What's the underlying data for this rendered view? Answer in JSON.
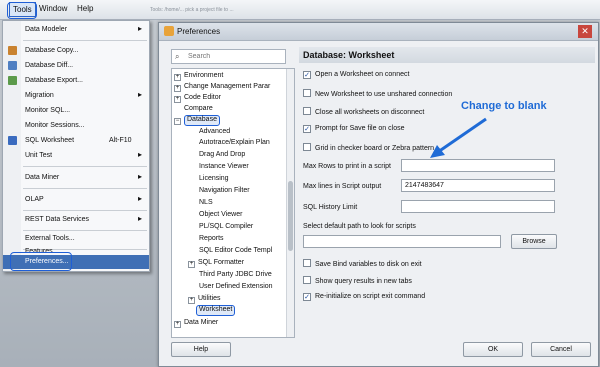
{
  "menubar": {
    "items": [
      "Tools",
      "Window",
      "Help"
    ],
    "bg_text": "Tools: /home/... pick a project file to ..."
  },
  "tools_menu": {
    "items": [
      {
        "label": "Data Modeler",
        "arrow": true,
        "icon": "none"
      },
      {
        "label": "Database Copy...",
        "icon": "db-copy-icon"
      },
      {
        "label": "Database Diff...",
        "icon": "db-diff-icon"
      },
      {
        "label": "Database Export...",
        "icon": "db-export-icon"
      },
      {
        "label": "Migration",
        "arrow": true,
        "icon": "none"
      },
      {
        "label": "Monitor SQL...",
        "icon": "none"
      },
      {
        "label": "Monitor Sessions...",
        "icon": "none"
      },
      {
        "label": "SQL Worksheet",
        "shortcut": "Alt-F10",
        "icon": "sql-worksheet-icon"
      },
      {
        "label": "Unit Test",
        "arrow": true,
        "icon": "none"
      },
      {
        "label": "Data Miner",
        "arrow": true,
        "icon": "none"
      },
      {
        "label": "OLAP",
        "arrow": true,
        "icon": "none"
      },
      {
        "label": "REST Data Services",
        "arrow": true,
        "icon": "none"
      },
      {
        "label": "External Tools...",
        "icon": "none"
      },
      {
        "label": "Features...",
        "icon": "none"
      },
      {
        "label": "Preferences...",
        "icon": "none"
      }
    ]
  },
  "dialog": {
    "title": "Preferences",
    "search_placeholder": "Search",
    "tree": [
      {
        "label": "Environment",
        "pm": "+"
      },
      {
        "label": "Change Management Parar",
        "pm": "+"
      },
      {
        "label": "Code Editor",
        "pm": "+"
      },
      {
        "label": "Compare",
        "pm": ""
      },
      {
        "label": "Database",
        "pm": "−"
      },
      {
        "label": "Advanced",
        "pm": ""
      },
      {
        "label": "Autotrace/Explain Plan",
        "pm": ""
      },
      {
        "label": "Drag And Drop",
        "pm": ""
      },
      {
        "label": "Instance Viewer",
        "pm": ""
      },
      {
        "label": "Licensing",
        "pm": ""
      },
      {
        "label": "Navigation Filter",
        "pm": ""
      },
      {
        "label": "NLS",
        "pm": ""
      },
      {
        "label": "Object Viewer",
        "pm": ""
      },
      {
        "label": "PL/SQL Compiler",
        "pm": ""
      },
      {
        "label": "Reports",
        "pm": ""
      },
      {
        "label": "SQL Editor Code Templ",
        "pm": ""
      },
      {
        "label": "SQL Formatter",
        "pm": "+"
      },
      {
        "label": "Third Party JDBC Drive",
        "pm": ""
      },
      {
        "label": "User Defined Extension",
        "pm": ""
      },
      {
        "label": "Utilities",
        "pm": "+"
      },
      {
        "label": "Worksheet",
        "pm": ""
      },
      {
        "label": "Data Miner",
        "pm": "+"
      }
    ],
    "panel_title": "Database: Worksheet",
    "options": {
      "open_on_connect": {
        "label": "Open a Worksheet on connect",
        "checked": true
      },
      "new_worksheet": {
        "label": "New Worksheet to use unshared connection",
        "checked": false
      },
      "close_all": {
        "label": "Close all worksheets on disconnect",
        "checked": false
      },
      "prompt_save": {
        "label": "Prompt for Save file on close",
        "checked": true
      },
      "grid_checker": {
        "label": "Grid in checker board or Zebra pattern",
        "checked": false
      }
    },
    "max_rows_label": "Max Rows to print in a script",
    "max_rows_value": "",
    "max_lines_label": "Max lines in Script output",
    "max_lines_value": "2147483647",
    "sql_history_label": "SQL History Limit",
    "sql_history_value": "",
    "default_path_label": "Select default path to look for scripts",
    "default_path_value": "",
    "browse": "Browse",
    "save_bind": {
      "label": "Save Bind variables to disk on exit",
      "checked": false
    },
    "show_query": {
      "label": "Show query results in new tabs",
      "checked": false
    },
    "reinit": {
      "label": "Re-initialize on script exit command",
      "checked": true
    },
    "help": "Help",
    "ok": "OK",
    "cancel": "Cancel"
  },
  "annotation": "Change to blank",
  "accent_color": "#1f6bd6"
}
